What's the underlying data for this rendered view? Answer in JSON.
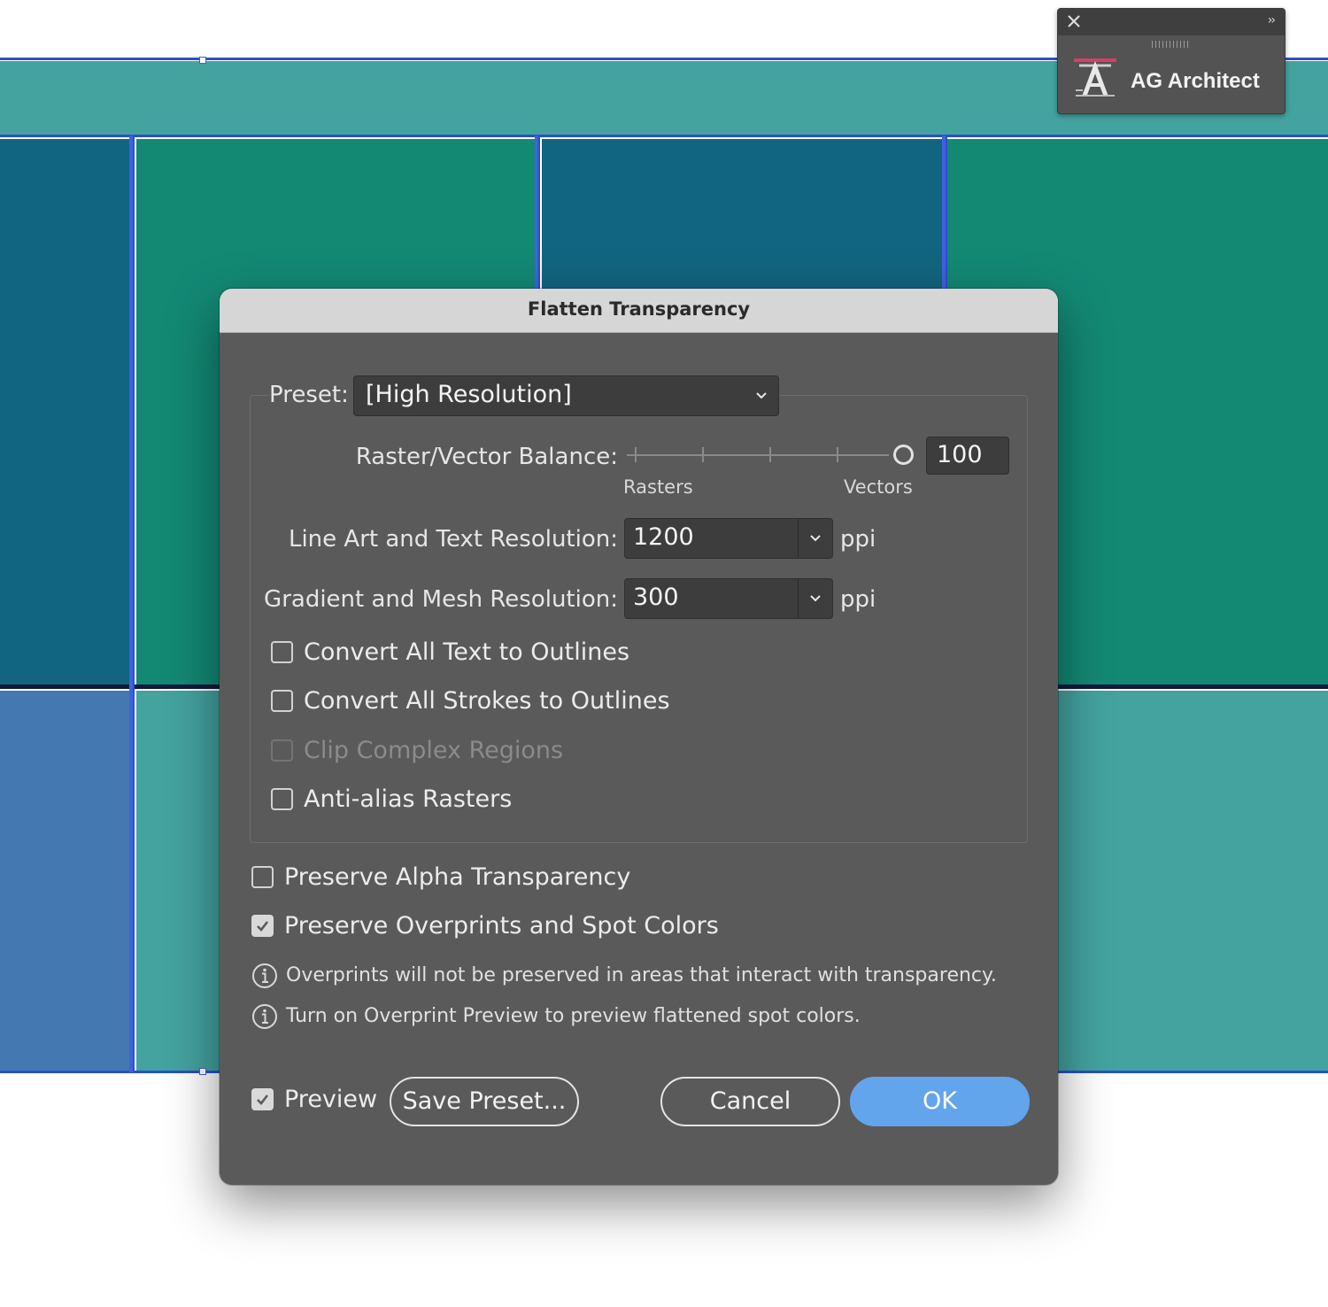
{
  "colors": {
    "tile_teal_light": "#44a39f",
    "tile_blue_dark": "#126580",
    "tile_green": "#138974",
    "tile_blue_mid": "#4378b1",
    "selection_guide": "#3f63e0",
    "dialog_bg": "#5a5a5a",
    "ok_button": "#63a5ec"
  },
  "panel": {
    "close_icon": "close-icon",
    "expand_label": "››",
    "item_label": "AG Architect",
    "item_icon": "text-tool-icon"
  },
  "dialog": {
    "title": "Flatten Transparency",
    "preset": {
      "label": "Preset:",
      "value": "[High Resolution]"
    },
    "balance": {
      "label": "Raster/Vector Balance:",
      "value": "100",
      "slider_fraction": 1.0,
      "left_label": "Rasters",
      "right_label": "Vectors"
    },
    "line_art": {
      "label": "Line Art and Text Resolution:",
      "value": "1200",
      "unit": "ppi"
    },
    "gradient": {
      "label": "Gradient and Mesh Resolution:",
      "value": "300",
      "unit": "ppi"
    },
    "options": [
      {
        "label": "Convert All Text to Outlines",
        "checked": false,
        "disabled": false
      },
      {
        "label": "Convert All Strokes to Outlines",
        "checked": false,
        "disabled": false
      },
      {
        "label": "Clip Complex Regions",
        "checked": false,
        "disabled": true
      },
      {
        "label": "Anti-alias Rasters",
        "checked": false,
        "disabled": false
      }
    ],
    "preserve_alpha": {
      "label": "Preserve Alpha Transparency",
      "checked": false
    },
    "preserve_overprints": {
      "label": "Preserve Overprints and Spot Colors",
      "checked": true
    },
    "info_1": "Overprints will not be preserved in areas that interact with transparency.",
    "info_2": "Turn on Overprint Preview to preview flattened spot colors.",
    "preview": {
      "label": "Preview",
      "checked": true
    },
    "save_preset_label": "Save Preset...",
    "cancel_label": "Cancel",
    "ok_label": "OK"
  }
}
